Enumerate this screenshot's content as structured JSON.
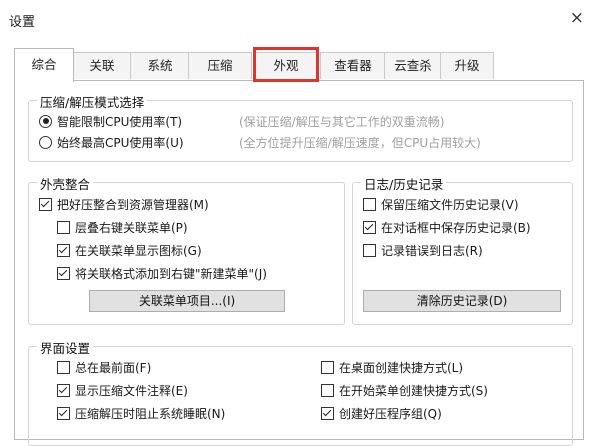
{
  "window": {
    "title": "设置",
    "close_glyph": "×"
  },
  "tabs": [
    {
      "label": "综合",
      "active": true
    },
    {
      "label": "关联"
    },
    {
      "label": "系统"
    },
    {
      "label": "压缩"
    },
    {
      "label": "外观",
      "highlighted": true
    },
    {
      "label": "查看器"
    },
    {
      "label": "云查杀"
    },
    {
      "label": "升级"
    }
  ],
  "mode_group": {
    "title": "压缩/解压模式选择",
    "options": [
      {
        "label": "智能限制CPU使用率(T)",
        "hint": "(保证压缩/解压与其它工作的双重流畅)",
        "selected": true
      },
      {
        "label": "始终最高CPU使用率(U)",
        "hint": "(全方位提升压缩/解压速度，但CPU占用较大)",
        "selected": false
      }
    ]
  },
  "shell_group": {
    "title": "外壳整合",
    "main": {
      "label": "把好压整合到资源管理器(M)",
      "checked": true
    },
    "items": [
      {
        "label": "层叠右键关联菜单(P)",
        "checked": false
      },
      {
        "label": "在关联菜单显示图标(G)",
        "checked": true
      },
      {
        "label": "将关联格式添加到右键\"新建菜单\"(J)",
        "checked": true
      }
    ],
    "button": "关联菜单项目...(I)"
  },
  "log_group": {
    "title": "日志/历史记录",
    "items": [
      {
        "label": "保留压缩文件历史记录(V)",
        "checked": false
      },
      {
        "label": "在对话框中保存历史记录(B)",
        "checked": true
      },
      {
        "label": "记录错误到日志(R)",
        "checked": false
      }
    ],
    "button": "清除历史记录(D)"
  },
  "ui_group": {
    "title": "界面设置",
    "left": [
      {
        "label": "总在最前面(F)",
        "checked": false
      },
      {
        "label": "显示压缩文件注释(E)",
        "checked": true
      },
      {
        "label": "压缩解压时阻止系统睡眠(N)",
        "checked": true
      }
    ],
    "right": [
      {
        "label": "在桌面创建快捷方式(L)",
        "checked": false
      },
      {
        "label": "在开始菜单创建快捷方式(S)",
        "checked": false
      },
      {
        "label": "创建好压程序组(Q)",
        "checked": true
      }
    ]
  }
}
